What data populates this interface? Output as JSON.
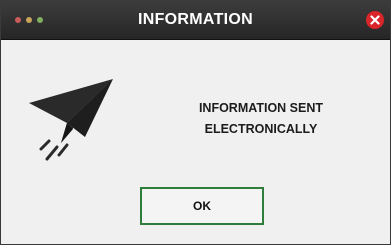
{
  "dialog": {
    "title": "INFORMATION",
    "message_line1": "INFORMATION SENT",
    "message_line2": "ELECTRONICALLY",
    "ok_label": "OK",
    "icon": "paper-plane-icon"
  },
  "window_controls": {
    "dots": [
      "#c95b5b",
      "#c9a55b",
      "#7fae5f"
    ],
    "close_icon": "close-icon",
    "close_color": "#d9262b"
  },
  "colors": {
    "titlebar": "#2f2f2f",
    "ok_border": "#2e7d3a"
  }
}
